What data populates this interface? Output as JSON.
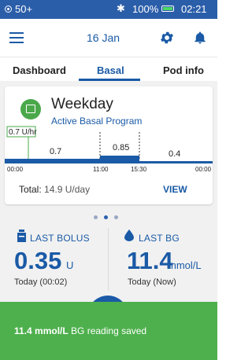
{
  "status_bar": {
    "carrier": "50+",
    "bluetooth": "✱",
    "battery_pct": "100%",
    "time": "02:21",
    "color": "#2b5ea9"
  },
  "header": {
    "date": "16 Jan",
    "icons": [
      "menu-icon",
      "gear-icon",
      "bell-icon"
    ]
  },
  "tabs": [
    {
      "label": "Dashboard",
      "active": false
    },
    {
      "label": "Basal",
      "active": true
    },
    {
      "label": "Pod info",
      "active": false
    }
  ],
  "basal_card": {
    "program_name": "Weekday",
    "program_status": "Active Basal Program",
    "current_rate": "0.7 U/hr",
    "segments": [
      {
        "start": "00:00",
        "end": "11:00",
        "rate": "0.7"
      },
      {
        "start": "11:00",
        "end": "15:30",
        "rate": "0.85"
      },
      {
        "start": "15:30",
        "end": "00:00",
        "rate": "0.4"
      }
    ],
    "time_labels": [
      "00:00",
      "11:00",
      "15:30",
      "00:00"
    ],
    "total_label": "Total:",
    "total_value": "14.9 U/day",
    "view_label": "VIEW"
  },
  "pager": {
    "count": 3,
    "active": 0
  },
  "last_bolus": {
    "title": "LAST BOLUS",
    "value": "0.35",
    "unit": "U",
    "time": "Today (00:02)"
  },
  "last_bg": {
    "title": "LAST BG",
    "value": "11.4",
    "unit": "mmol/L",
    "time": "Today (Now)"
  },
  "snackbar": {
    "value": "11.4 mmol/L",
    "message": " BG reading saved",
    "color": "#4eb04d"
  }
}
